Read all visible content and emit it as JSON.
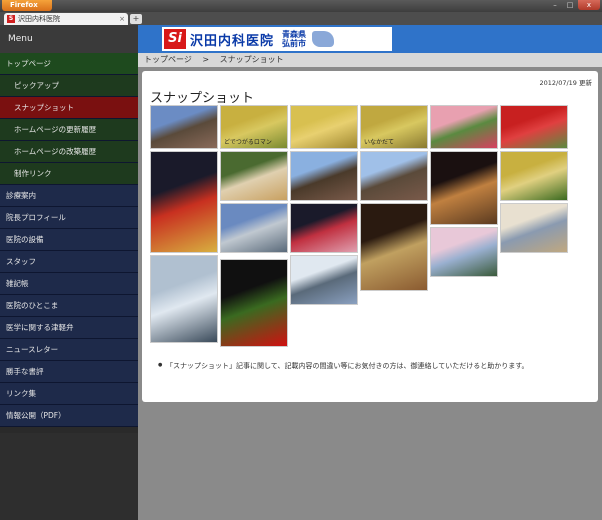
{
  "browser": {
    "app_button": "Firefox",
    "tab_title": "沢田内科医院",
    "tab_close": "×",
    "new_tab": "+",
    "window_controls": {
      "minimize": "–",
      "maximize": "□",
      "close": "x"
    }
  },
  "sidebar": {
    "menu_label": "Menu",
    "items": [
      {
        "label": "トップページ",
        "type": "top"
      },
      {
        "label": "ピックアップ",
        "type": "sub"
      },
      {
        "label": "スナップショット",
        "type": "sub-active"
      },
      {
        "label": "ホームページの更新履歴",
        "type": "sub"
      },
      {
        "label": "ホームページの改築履歴",
        "type": "sub"
      },
      {
        "label": "制作リンク",
        "type": "sub"
      },
      {
        "label": "診療案内",
        "type": "main"
      },
      {
        "label": "院長プロフィール",
        "type": "main"
      },
      {
        "label": "医院の設備",
        "type": "main"
      },
      {
        "label": "スタッフ",
        "type": "main"
      },
      {
        "label": "雑記帳",
        "type": "main"
      },
      {
        "label": "医院のひとこま",
        "type": "main"
      },
      {
        "label": "医学に関する津軽弁",
        "type": "main"
      },
      {
        "label": "ニュースレター",
        "type": "main"
      },
      {
        "label": "勝手な書評",
        "type": "main"
      },
      {
        "label": "リンク集",
        "type": "main"
      },
      {
        "label": "情報公開（PDF）",
        "type": "main"
      }
    ]
  },
  "banner": {
    "logo_mark": "Si",
    "clinic_name": "沢田内科医院",
    "prefecture": "青森県",
    "city": "弘前市"
  },
  "breadcrumb": {
    "home": "トップページ",
    "separator": ">",
    "current": "スナップショット"
  },
  "content": {
    "updated": "2012/07/19 更新",
    "title": "スナップショット",
    "note": "「スナップショット」記事に関して、記載内容の間違い等にお気付きの方は、御連絡していただけると助かります。"
  },
  "colors": {
    "banner_blue": "#2f73c9",
    "active_red": "#7a1010",
    "nav_green": "#1e4a1e",
    "nav_navy": "#1e2a4a"
  },
  "photos": [
    {
      "name": "clinic-building-photo",
      "colors": [
        "#6b8cc4",
        "#8a6a5a",
        "#5a4a3a"
      ]
    },
    {
      "name": "rice-paddy-art-photo",
      "colors": [
        "#c8b040",
        "#7a8a30",
        "#d8c860"
      ],
      "caption": "どでつがるロマン"
    },
    {
      "name": "rice-paddy-wave-photo",
      "colors": [
        "#d8c050",
        "#a08830",
        "#e8d070"
      ]
    },
    {
      "name": "rice-paddy-mountain-photo",
      "colors": [
        "#c0a840",
        "#8a7a30",
        "#d8c860"
      ],
      "caption": "いなかだて"
    },
    {
      "name": "tulip-field-photo",
      "colors": [
        "#e8a0b0",
        "#d84060",
        "#5a8a40"
      ]
    },
    {
      "name": "red-tulips-photo",
      "colors": [
        "#c82020",
        "#5a8a40",
        "#e04040"
      ]
    },
    {
      "name": "nebuta-mask-photo",
      "colors": [
        "#1a1a2a",
        "#d8b040",
        "#c83020"
      ]
    },
    {
      "name": "garden-flowers-photo",
      "colors": [
        "#4a6a30",
        "#c8a060",
        "#e0d0b0"
      ]
    },
    {
      "name": "clinic-evening-photo",
      "colors": [
        "#8ab0e0",
        "#7a5a4a",
        "#4a3a2a"
      ]
    },
    {
      "name": "clinic-street-photo",
      "colors": [
        "#a0c0e8",
        "#7a5a4a",
        "#5a4a3a"
      ]
    },
    {
      "name": "castle-tower-photo",
      "colors": [
        "#1a1010",
        "#5a3a20",
        "#c08040"
      ]
    },
    {
      "name": "rice-paddy-green-photo",
      "colors": [
        "#c8b040",
        "#3a6a20",
        "#e0d080"
      ]
    },
    {
      "name": "mount-iwaki-city-photo",
      "colors": [
        "#6a8ac0",
        "#5a6a7a",
        "#c0c8d0"
      ]
    },
    {
      "name": "lantern-festival-photo",
      "colors": [
        "#1a1a2a",
        "#e0a0b0",
        "#c03040"
      ]
    },
    {
      "name": "taiko-drum-photo",
      "colors": [
        "#2a1a10",
        "#8a5a30",
        "#c0a060"
      ]
    },
    {
      "name": "cherry-blossom-castle-photo",
      "colors": [
        "#e8c8d8",
        "#3a5a3a",
        "#9ab0d0"
      ]
    },
    {
      "name": "cat-photo",
      "colors": [
        "#e8e0d0",
        "#c0a880",
        "#8a9ab0"
      ]
    },
    {
      "name": "frozen-waterfall-photo",
      "colors": [
        "#b0c0d0",
        "#3a4a5a",
        "#e0e8f0"
      ]
    },
    {
      "name": "amaryllis-flower-photo",
      "colors": [
        "#101010",
        "#d01010",
        "#3a6a20"
      ]
    },
    {
      "name": "snowy-town-photo",
      "colors": [
        "#e0e8f0",
        "#8aa0c0",
        "#5a6a7a"
      ]
    }
  ]
}
